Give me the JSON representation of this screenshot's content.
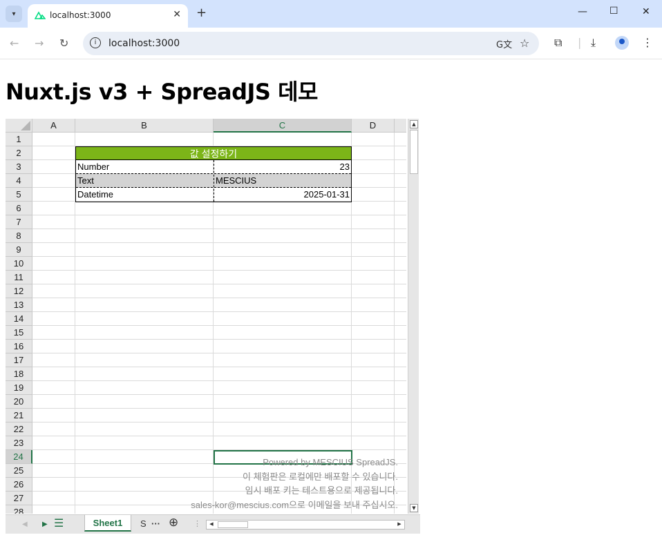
{
  "browser": {
    "tab_title": "localhost:3000",
    "url": "localhost:3000",
    "icons": [
      "chevron-down-icon",
      "nuxt-favicon",
      "close-icon",
      "plus-icon",
      "minimize-icon",
      "maximize-icon",
      "close-window-icon",
      "back-icon",
      "forward-icon",
      "reload-icon",
      "info-icon",
      "translate-icon",
      "star-icon",
      "extensions-icon",
      "download-icon",
      "profile-icon",
      "menu-icon"
    ]
  },
  "page": {
    "heading": "Nuxt.js v3 + SpreadJS 데모"
  },
  "spreadsheet": {
    "columns": [
      "A",
      "B",
      "C",
      "D"
    ],
    "selected_column": "C",
    "rows": [
      "1",
      "2",
      "3",
      "4",
      "5",
      "6",
      "7",
      "8",
      "9",
      "10",
      "11",
      "12",
      "13",
      "14",
      "15",
      "16",
      "17",
      "18",
      "19",
      "20",
      "21",
      "22",
      "23",
      "24",
      "25",
      "26",
      "27",
      "28"
    ],
    "selected_row": "24",
    "table_title": "값 설정하기",
    "table_title_color": "#7cb518",
    "table": [
      {
        "label": "Number",
        "value": "23"
      },
      {
        "label": "Text",
        "value": "MESCIUS"
      },
      {
        "label": "Datetime",
        "value": "2025-01-31"
      }
    ],
    "sheet_tabs": [
      "Sheet1",
      "S"
    ],
    "active_sheet": "Sheet1",
    "accent_color": "#217346",
    "watermark": [
      "Powered by MESCIUS SpreadJS.",
      "이 체험판은 로컬에만 배포할 수 있습니다.",
      "임시 배포 키는 테스트용으로 제공됩니다.",
      "sales-kor@mescius.com으로 이메일을 보내 주십시오."
    ]
  }
}
